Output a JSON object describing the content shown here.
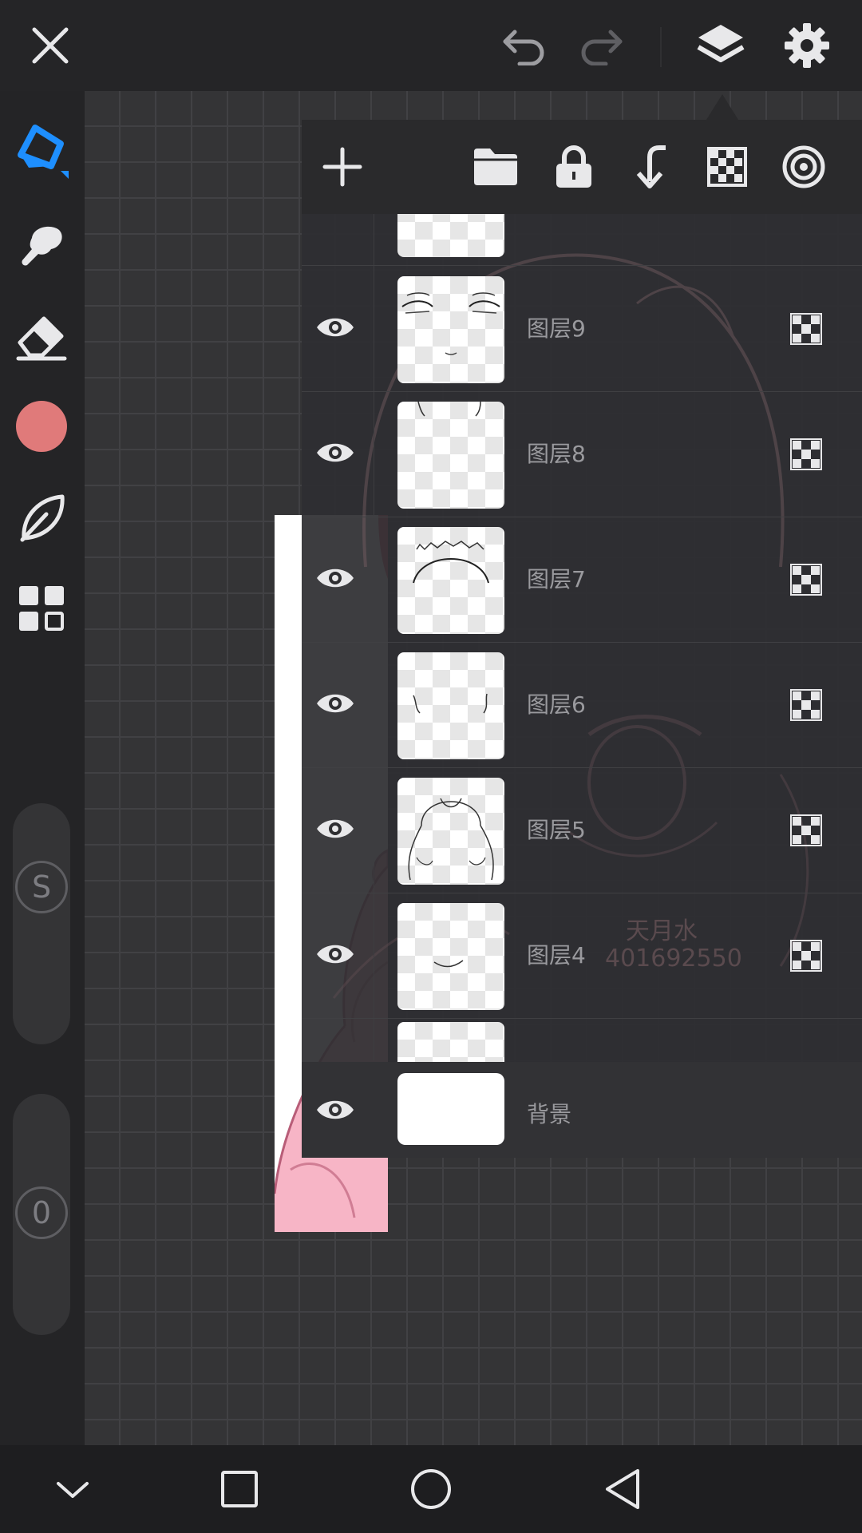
{
  "colors": {
    "accent": "#1e8fff",
    "current_brush_color": "#e07a7a",
    "icon_light": "#e8e8ea",
    "icon_dim": "#5f5f63"
  },
  "topbar": {
    "icons": [
      "close-icon",
      "undo-icon",
      "redo-icon",
      "layers-icon",
      "settings-icon"
    ]
  },
  "sidebar": {
    "tools": [
      "pen-tool-icon",
      "smudge-tool-icon",
      "eraser-tool-icon",
      "color-swatch",
      "leaf-brush-icon",
      "grid-panel-icon"
    ],
    "size_slider_label": "S",
    "opacity_slider_label": "0"
  },
  "layers_panel": {
    "toolbar_icons": [
      "add-layer-icon",
      "folder-icon",
      "lock-icon",
      "merge-down-icon",
      "transparency-icon",
      "target-icon"
    ],
    "layers": [
      {
        "name": "图层9",
        "visible": true
      },
      {
        "name": "图层8",
        "visible": true
      },
      {
        "name": "图层7",
        "visible": true
      },
      {
        "name": "图层6",
        "visible": true
      },
      {
        "name": "图层5",
        "visible": true
      },
      {
        "name": "图层4",
        "visible": true
      }
    ],
    "background_layer": {
      "name": "背景",
      "visible": true
    }
  },
  "watermark": {
    "handle": "天月水",
    "id": "401692550"
  },
  "navbar": {
    "icons": [
      "chevron-down-icon",
      "recents-icon",
      "home-icon",
      "back-icon"
    ]
  }
}
